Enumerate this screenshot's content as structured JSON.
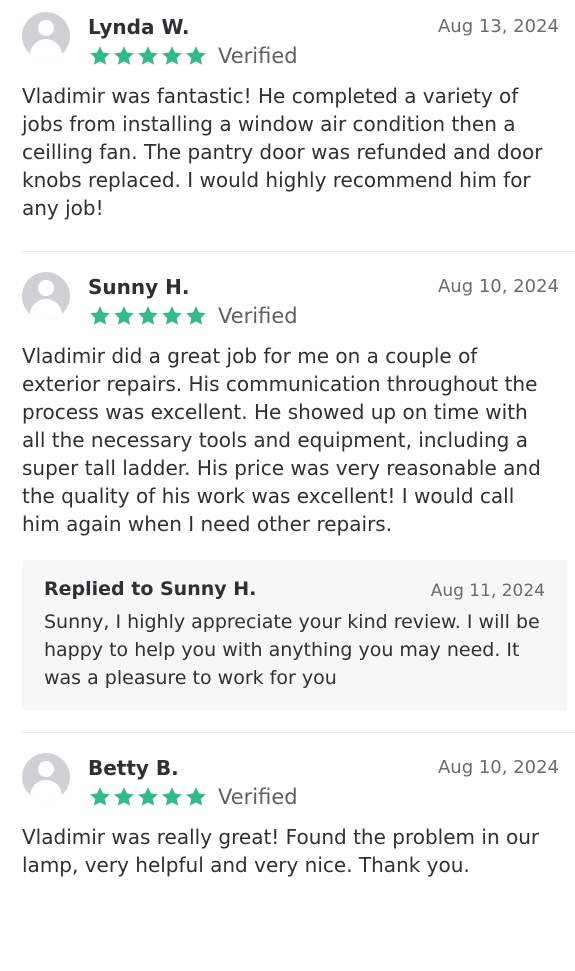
{
  "theme": {
    "star_color": "#34b98a",
    "avatar_color": "#cfd1d4",
    "divider_color": "#e6e7ea",
    "reply_background": "#f7f7f8"
  },
  "reviews": [
    {
      "name": "Lynda W.",
      "date": "Aug 13, 2024",
      "rating": 5,
      "verified_label": "Verified",
      "text": "Vladimir was fantastic! He completed a variety of jobs from installing a window air condition then a ceilling fan. The pantry door was refunded and door knobs replaced. I would highly recommend him for any job!"
    },
    {
      "name": "Sunny H.",
      "date": "Aug 10, 2024",
      "rating": 5,
      "verified_label": "Verified",
      "text": "Vladimir did a great job for me on a couple of exterior repairs.  His communication throughout the process was excellent.  He showed up on time with all the necessary tools and equipment, including a super tall ladder.  His price was very reasonable and the quality of his work was excellent!  I would call him again when I need other repairs.",
      "reply": {
        "title": "Replied to Sunny H.",
        "date": "Aug 11, 2024",
        "text": "Sunny, I highly appreciate your kind review. I will be happy to help you with anything you may need. It was a pleasure to work for you"
      }
    },
    {
      "name": "Betty B.",
      "date": "Aug 10, 2024",
      "rating": 5,
      "verified_label": "Verified",
      "text": "Vladimir was really great! Found the problem in our lamp, very helpful and very nice. Thank you."
    }
  ]
}
